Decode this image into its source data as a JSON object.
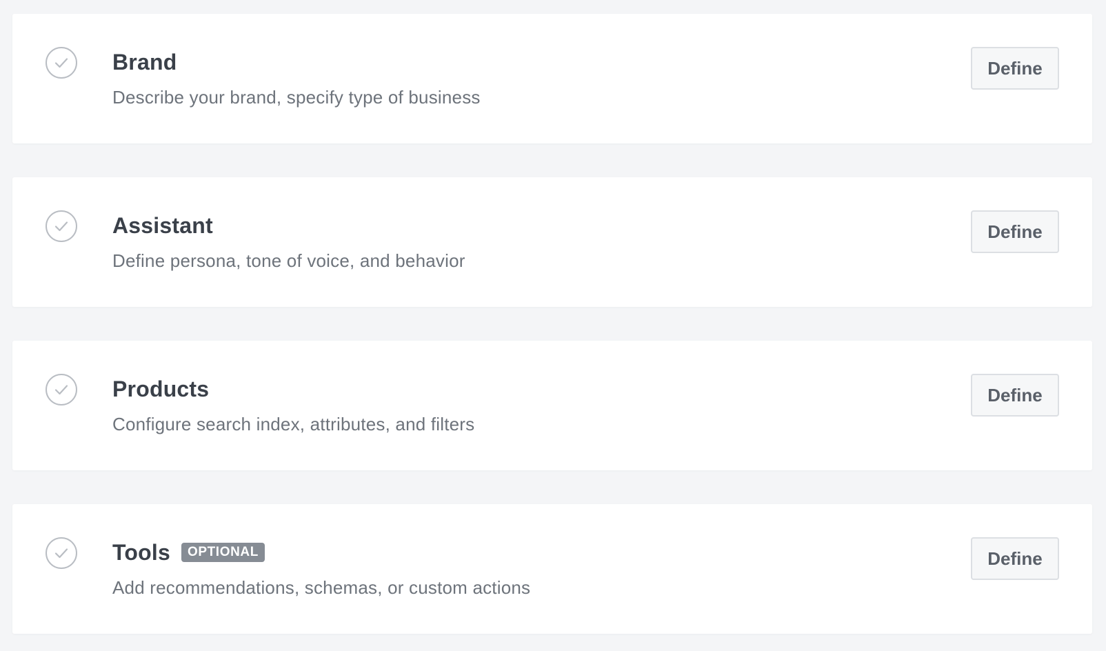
{
  "colors": {
    "background": "#f4f5f7",
    "card": "#ffffff",
    "title": "#3a4049",
    "description": "#6d737b",
    "badge": "#868c94",
    "check": "#b9bdc3",
    "button_border": "#dcdfe3"
  },
  "steps": [
    {
      "title": "Brand",
      "description": "Describe your brand, specify type of business",
      "badge": "",
      "button_label": "Define",
      "status_icon": "check-circle-icon"
    },
    {
      "title": "Assistant",
      "description": "Define persona, tone of voice, and behavior",
      "badge": "",
      "button_label": "Define",
      "status_icon": "check-circle-icon"
    },
    {
      "title": "Products",
      "description": "Configure search index, attributes, and filters",
      "badge": "",
      "button_label": "Define",
      "status_icon": "check-circle-icon"
    },
    {
      "title": "Tools",
      "description": "Add recommendations, schemas, or custom actions",
      "badge": "OPTIONAL",
      "button_label": "Define",
      "status_icon": "check-circle-icon"
    }
  ]
}
